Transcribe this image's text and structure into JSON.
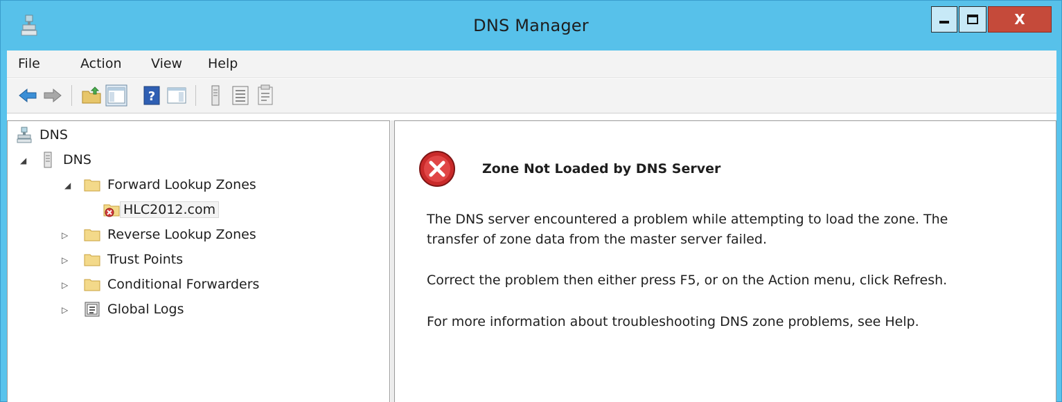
{
  "window": {
    "title": "DNS Manager",
    "close_glyph": "X",
    "accent_color": "#57c1ea",
    "close_color": "#c54a3a"
  },
  "menu": {
    "items": [
      "File",
      "Action",
      "View",
      "Help"
    ]
  },
  "toolbar": {
    "buttons": [
      "back-arrow-icon",
      "forward-arrow-icon",
      "up-folder-icon",
      "show-hide-console-tree-icon",
      "help-icon",
      "show-hide-action-pane-icon",
      "server-icon",
      "list-icon",
      "properties-icon"
    ]
  },
  "tree": {
    "root": {
      "label": "DNS",
      "icon": "dns-console-icon"
    },
    "server": {
      "label": "DNS",
      "icon": "server-icon"
    },
    "forward_zones": {
      "label": "Forward Lookup Zones",
      "icon": "folder-icon"
    },
    "zone": {
      "label": "HLC2012.com",
      "icon": "zone-error-icon"
    },
    "reverse_zones": {
      "label": "Reverse Lookup Zones",
      "icon": "folder-icon"
    },
    "trust_points": {
      "label": "Trust Points",
      "icon": "folder-icon"
    },
    "conditional_forwarders": {
      "label": "Conditional Forwarders",
      "icon": "folder-icon"
    },
    "global_logs": {
      "label": "Global Logs",
      "icon": "event-log-icon"
    }
  },
  "result": {
    "title": "Zone Not Loaded by DNS Server",
    "para1_line1": "The DNS server encountered a problem while attempting to load the zone. The",
    "para1_line2": "transfer of zone data from the master server failed.",
    "para2": "Correct the problem then either press F5, or on the Action menu, click Refresh.",
    "para3": "For more information about troubleshooting DNS zone problems, see Help."
  }
}
